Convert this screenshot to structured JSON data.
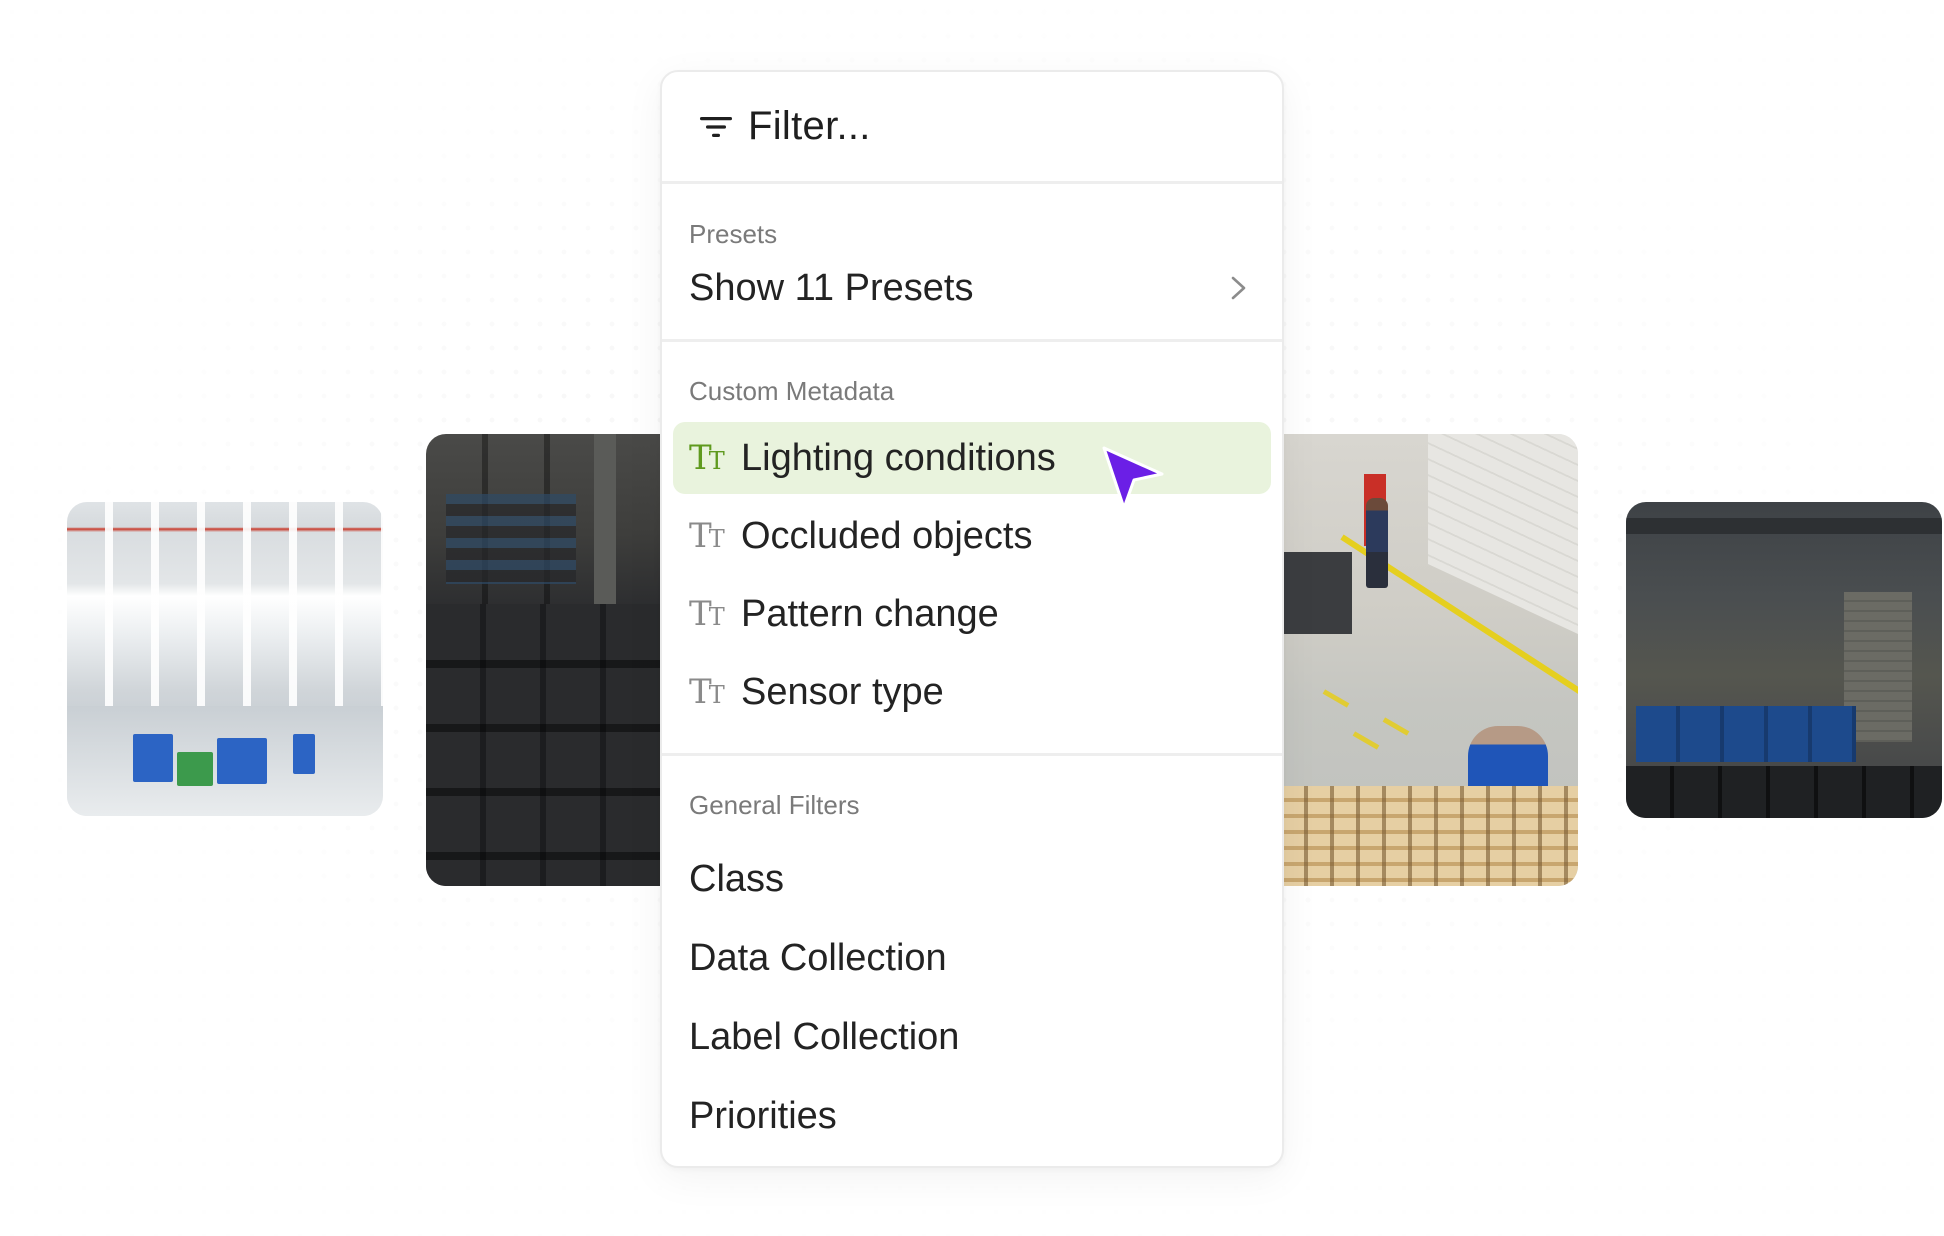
{
  "filter": {
    "title": "Filter..."
  },
  "presets": {
    "section_label": "Presets",
    "show_label": "Show 11 Presets"
  },
  "custom_metadata": {
    "section_label": "Custom Metadata",
    "items": [
      {
        "label": "Lighting conditions",
        "selected": true,
        "icon": "text-type-icon"
      },
      {
        "label": "Occluded objects",
        "selected": false,
        "icon": "text-type-icon"
      },
      {
        "label": "Pattern change",
        "selected": false,
        "icon": "text-type-icon"
      },
      {
        "label": "Sensor type",
        "selected": false,
        "icon": "text-type-icon"
      }
    ]
  },
  "general_filters": {
    "section_label": "General Filters",
    "items": [
      {
        "label": "Class"
      },
      {
        "label": "Data Collection"
      },
      {
        "label": "Label Collection"
      },
      {
        "label": "Priorities"
      }
    ]
  },
  "colors": {
    "selected_background": "#e9f3dd",
    "selected_icon": "#5f9a1e",
    "cursor": "#6b1fe6"
  },
  "icons": [
    "filter-icon",
    "chevron-right-icon",
    "text-type-icon",
    "cursor-pointer-icon"
  ]
}
